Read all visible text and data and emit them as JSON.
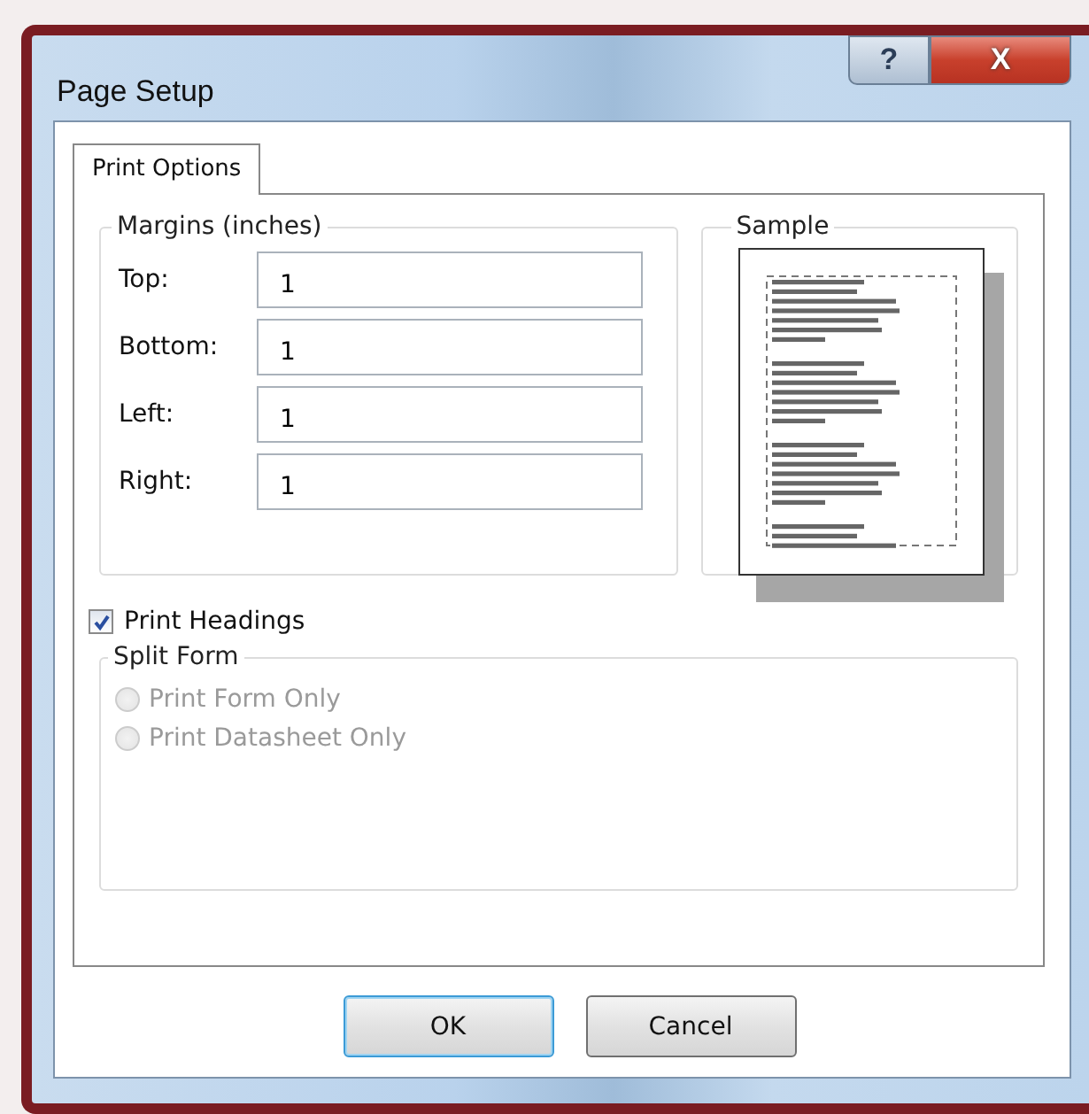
{
  "window": {
    "title": "Page Setup",
    "title_buttons": [
      {
        "kind": "help",
        "label": "?"
      },
      {
        "kind": "close",
        "label": "X"
      }
    ]
  },
  "tabs": [
    {
      "label": "Print Options",
      "selected": true
    }
  ],
  "margins": {
    "title": "Margins (inches)",
    "fields": [
      {
        "label": "Top:",
        "value": "1"
      },
      {
        "label": "Bottom:",
        "value": "1"
      },
      {
        "label": "Left:",
        "value": "1"
      },
      {
        "label": "Right:",
        "value": "1"
      }
    ]
  },
  "sample": {
    "title": "Sample"
  },
  "print_headings": {
    "label": "Print Headings",
    "checked": true
  },
  "split_form": {
    "title": "Split Form",
    "options": [
      {
        "label": "Print Form Only",
        "selected": false,
        "disabled": true
      },
      {
        "label": "Print Datasheet Only",
        "selected": false,
        "disabled": true
      }
    ]
  },
  "buttons": [
    {
      "label": "OK",
      "default": true
    },
    {
      "label": "Cancel",
      "default": false
    }
  ]
}
